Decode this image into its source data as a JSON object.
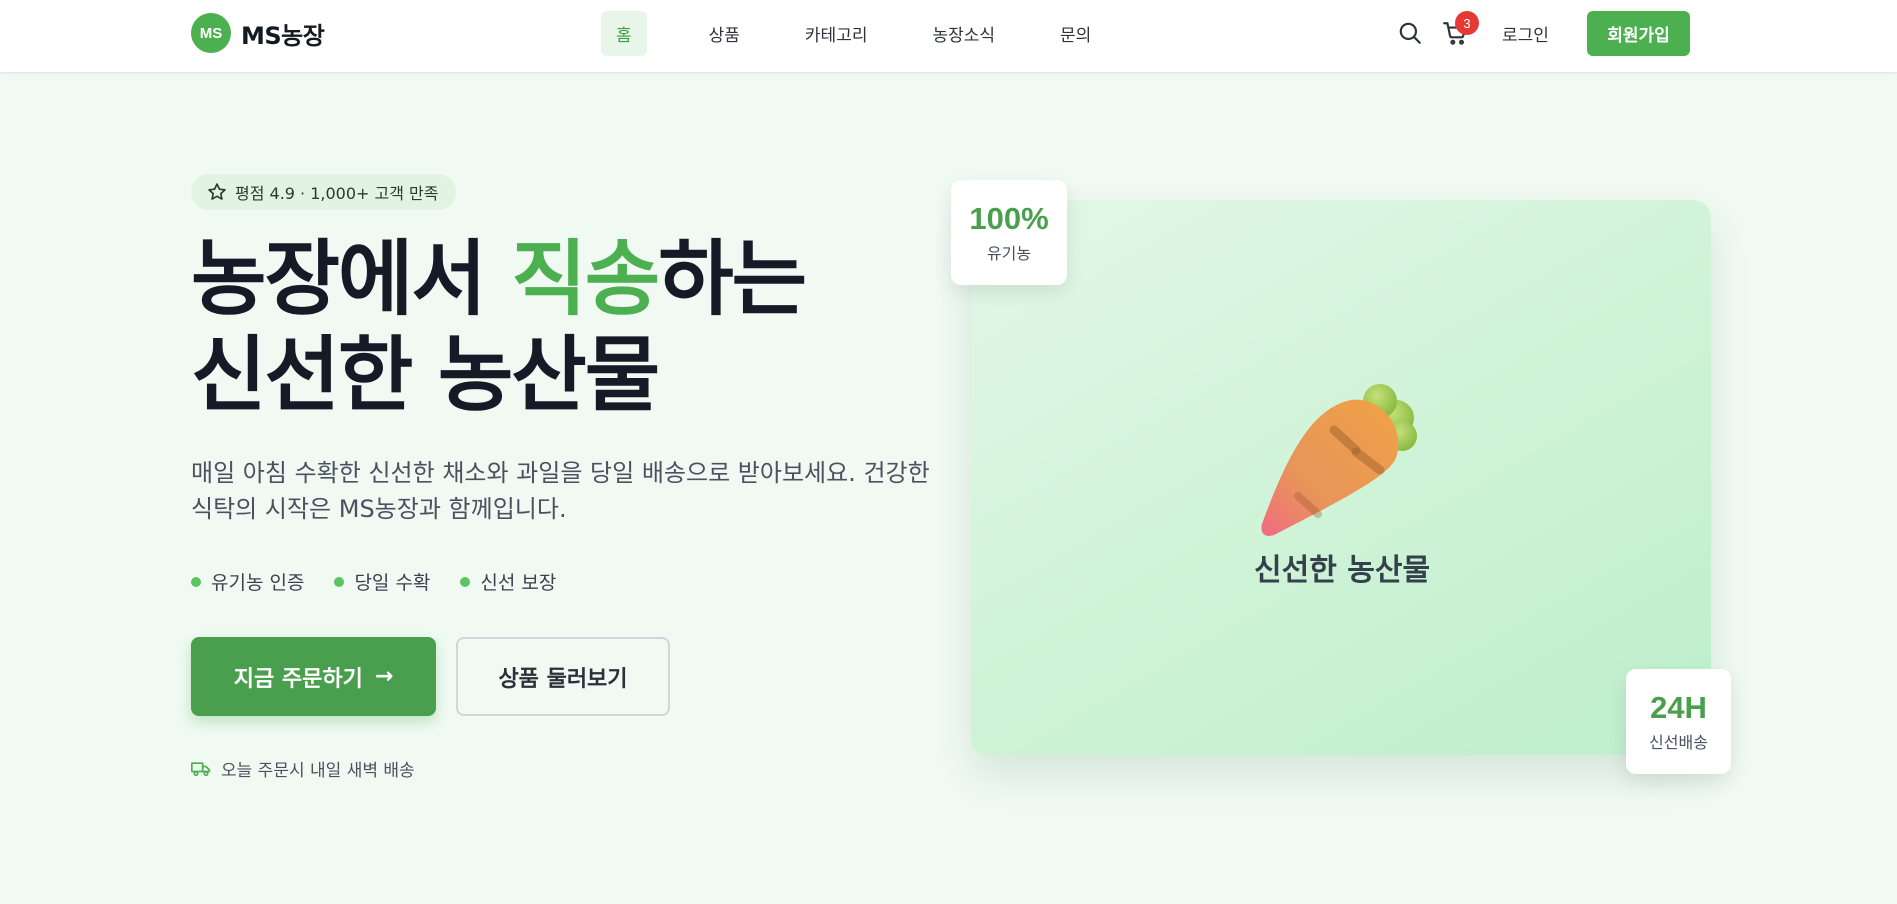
{
  "header": {
    "logo_badge": "MS",
    "logo_text": "MS농장",
    "nav": [
      {
        "label": "홈",
        "active": true
      },
      {
        "label": "상품",
        "active": false
      },
      {
        "label": "카테고리",
        "active": false
      },
      {
        "label": "농장소식",
        "active": false
      },
      {
        "label": "문의",
        "active": false
      }
    ],
    "cart_count": "3",
    "login_label": "로그인",
    "signup_label": "회원가입",
    "icons": [
      "search-icon",
      "cart-icon"
    ]
  },
  "hero": {
    "rating_text": "평점 4.9 · 1,000+ 고객 만족",
    "title_part1": "농장에서 ",
    "title_accent": "직송",
    "title_part2": "하는",
    "title_line2": "신선한 농산물",
    "description": "매일 아침 수확한 신선한 채소와 과일을 당일 배송으로 받아보세요. 건강한 식탁의 시작은 MS농장과 함께입니다.",
    "features": [
      "유기농 인증",
      "당일 수확",
      "신선 보장"
    ],
    "primary_button": "지금 주문하기",
    "primary_arrow": "→",
    "secondary_button": "상품 둘러보기",
    "delivery_note": "오늘 주문시 내일 새벽 배송"
  },
  "card": {
    "label": "신선한 농산물",
    "image": "carrot-icon",
    "stats": [
      {
        "value": "100%",
        "label": "유기농"
      },
      {
        "value": "24H",
        "label": "신선배송"
      }
    ]
  },
  "colors": {
    "accent": "#4caf50",
    "accent_dark": "#4a9f4e",
    "badge_red": "#e53935",
    "background": "#f0faf3"
  }
}
